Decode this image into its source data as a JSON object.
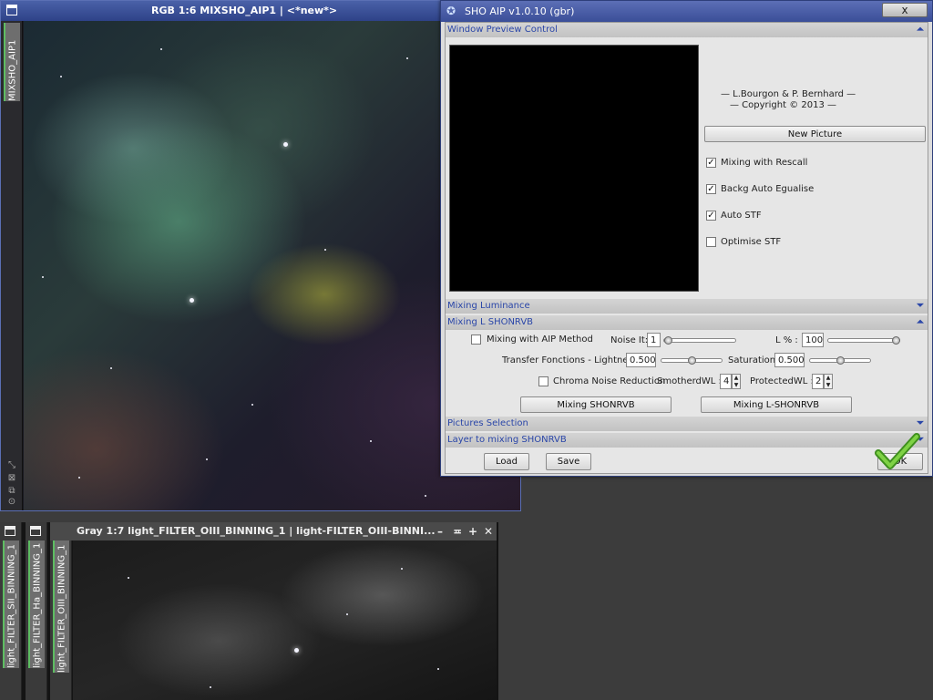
{
  "rgb_window": {
    "title": "RGB 1:6 MIXSHO_AIP1 | <*new*>",
    "side_tab": "MIXSHO_AIP1"
  },
  "gray_window": {
    "title": "Gray 1:7 light_FILTER_OIII_BINNING_1 | light-FILTER_OIII-BINNI...",
    "tabs": [
      "light_FILTER_SII_BINNING_1",
      "light_FILTER_Ha_BINNING_1",
      "light_FILTER_OIII_BINNING_1"
    ]
  },
  "dialog": {
    "title": "SHO AIP v1.0.10 (gbr)",
    "close_label": "x",
    "sections": {
      "preview": "Window Preview Control",
      "mixing_luminance": "Mixing Luminance",
      "mixing_l_shonrvb": "Mixing L SHONRVB",
      "pictures_selection": "Pictures Selection",
      "layer_to_mixing": "Layer to mixing SHONRVB"
    },
    "credits": [
      "— L.Bourgon & P. Bernhard —",
      "— Copyright © 2013 —"
    ],
    "new_picture_label": "New Picture",
    "options": [
      {
        "label": "Mixing with Rescall",
        "checked": true
      },
      {
        "label": "Backg Auto Egualise",
        "checked": true
      },
      {
        "label": "Auto STF",
        "checked": true
      },
      {
        "label": "Optimise STF",
        "checked": false
      }
    ],
    "mixing": {
      "aip_method_label": "Mixing with AIP Method",
      "aip_method_checked": false,
      "noise_it_label": "Noise It:",
      "noise_it_value": "1",
      "l_percent_label": "L % :",
      "l_percent_value": "100",
      "transfer_label": "Transfer Fonctions - Lightness:",
      "transfer_value": "0.500",
      "saturation_label": "Saturation:",
      "saturation_value": "0.500",
      "chroma_label": "Chroma Noise Reduction",
      "chroma_checked": false,
      "smoothed_label": "SmotherdWL :",
      "smoothed_value": "4",
      "protected_label": "ProtectedWL :",
      "protected_value": "2",
      "mix_shonrvb_label": "Mixing SHONRVB",
      "mix_l_shonrvb_label": "Mixing L-SHONRVB"
    },
    "load_label": "Load",
    "save_label": "Save",
    "ok_label": "OK"
  }
}
